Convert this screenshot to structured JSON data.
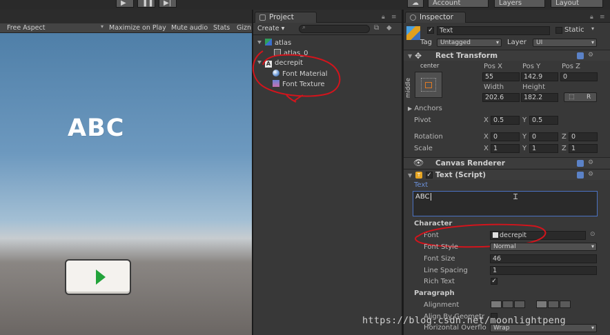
{
  "toolbar": {
    "account": "Account",
    "layers": "Layers",
    "layout": "Layout"
  },
  "game_view": {
    "aspect": "Free Aspect",
    "maximize": "Maximize on Play",
    "mute": "Mute audio",
    "stats": "Stats",
    "gizmos": "Gizn",
    "text_content": "ABC"
  },
  "project": {
    "tab_label": "Project",
    "create_label": "Create",
    "tree": [
      {
        "label": "atlas",
        "indent": 0,
        "icon": "sprite-atlas-icon"
      },
      {
        "label": "atlas_0",
        "indent": 1,
        "icon": "sprite-icon"
      },
      {
        "label": "decrepit",
        "indent": 0,
        "icon": "font-icon"
      },
      {
        "label": "Font Material",
        "indent": 1,
        "icon": "material-icon"
      },
      {
        "label": "Font Texture",
        "indent": 1,
        "icon": "texture-icon"
      }
    ]
  },
  "inspector": {
    "tab_label": "Inspector",
    "object_name": "Text",
    "static_label": "Static",
    "tag_label": "Tag",
    "tag_value": "Untagged",
    "layer_label": "Layer",
    "layer_value": "UI",
    "rect_transform": {
      "title": "Rect Transform",
      "anchor_h": "center",
      "anchor_v": "middle",
      "pos_x_label": "Pos X",
      "pos_y_label": "Pos Y",
      "pos_z_label": "Pos Z",
      "pos_x": "55",
      "pos_y": "142.9",
      "pos_z": "0",
      "width_label": "Width",
      "height_label": "Height",
      "width": "202.6",
      "height": "182.2",
      "r_btn": "R",
      "anchors_label": "Anchors",
      "pivot_label": "Pivot",
      "pivot_x": "0.5",
      "pivot_y": "0.5",
      "rotation_label": "Rotation",
      "rot_x": "0",
      "rot_y": "0",
      "rot_z": "0",
      "scale_label": "Scale",
      "scale_x": "1",
      "scale_y": "1",
      "scale_z": "1",
      "x": "X",
      "y": "Y",
      "z": "Z"
    },
    "canvas_renderer": {
      "title": "Canvas Renderer"
    },
    "text_script": {
      "title": "Text (Script)",
      "text_label": "Text",
      "text_value": "ABC",
      "character_label": "Character",
      "font_label": "Font",
      "font_value": "decrepit",
      "font_style_label": "Font Style",
      "font_style_value": "Normal",
      "font_size_label": "Font Size",
      "font_size_value": "46",
      "line_spacing_label": "Line Spacing",
      "line_spacing_value": "1",
      "rich_text_label": "Rich Text",
      "paragraph_label": "Paragraph",
      "alignment_label": "Alignment",
      "align_geometry_label": "Align By Geometr",
      "horizontal_overflow_label": "Horizontal Overflo",
      "horizontal_overflow_value": "Wrap"
    }
  },
  "watermark": "https://blog.csdn.net/moonlightpeng"
}
